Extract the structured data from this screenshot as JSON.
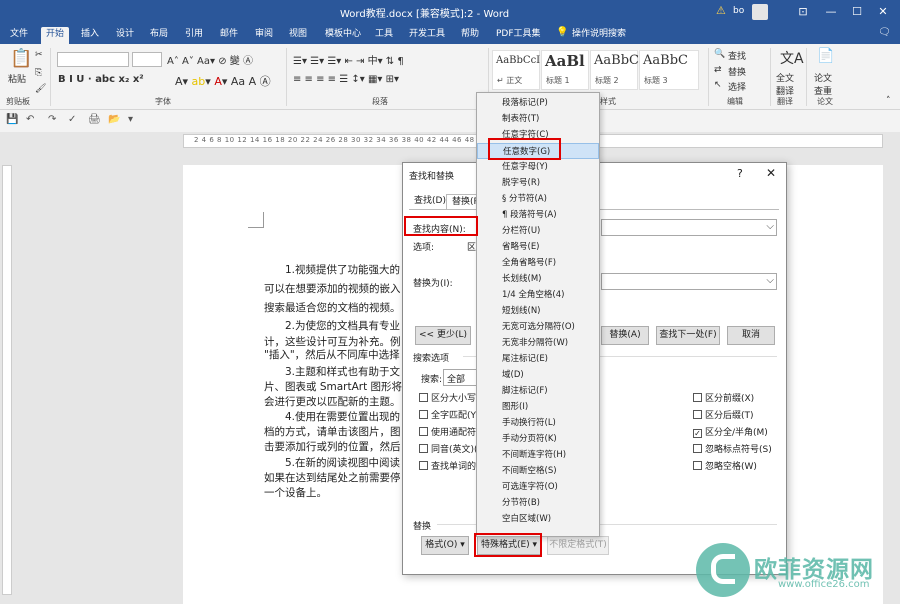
{
  "window": {
    "title": "Word教程.docx [兼容模式]:2 - Word",
    "user": "bo",
    "buttons": {
      "ribbon_display": "⊡",
      "minimize": "—",
      "maximize": "☐",
      "close": "✕"
    }
  },
  "tabs": [
    "文件",
    "开始",
    "插入",
    "设计",
    "布局",
    "引用",
    "邮件",
    "审阅",
    "视图",
    "模板中心",
    "工具",
    "开发工具",
    "帮助",
    "PDF工具集",
    "操作说明搜索"
  ],
  "active_tab": "开始",
  "ribbon": {
    "paste": "粘贴",
    "clipboard": "剪贴板",
    "font_group": "字体",
    "paragraph_group": "段落",
    "styles_group": "样式",
    "editing_group": "编辑",
    "translate_group": "翻译",
    "paper_group": "论文",
    "format_row": "B I U · abc x₂ x²",
    "styles": [
      {
        "preview": "AaBbCcI",
        "name": "↵ 正文"
      },
      {
        "preview": "AaBl",
        "name": "标题 1"
      },
      {
        "preview": "AaBbC",
        "name": "标题 2"
      },
      {
        "preview": "AaBbC",
        "name": "标题 3"
      }
    ],
    "find": "查找",
    "replace": "替换",
    "select": "选择",
    "full_translate": "全文\n翻译",
    "paper_check": "论文\n查重"
  },
  "ruler_text": "2  4  6  8  10  12  14  16  18  20  22  24  26  28  30  32  34  36  38  40  42  44  46  48",
  "document": {
    "lines": [
      "1.视频提供了功能强大的",
      "可以在想要添加的视频的嵌入",
      "搜索最适合您的文档的视频。",
      "2.为使您的文档具有专业",
      "计，这些设计可互为补充。例",
      "\"插入\"，然后从不同库中选择",
      "3.主题和样式也有助于文",
      "片、图表或 SmartArt 图形将",
      "会进行更改以匹配新的主题。",
      "4.使用在需要位置出现的",
      "档的方式，请单击该图片，图",
      "击要添加行或列的位置，然后",
      "5.在新的阅读视图中阅读",
      "如果在达到结尾处之前需要停",
      "一个设备上。"
    ]
  },
  "dialog": {
    "title": "查找和替换",
    "help": "?",
    "close": "✕",
    "tabs": [
      "查找(D)",
      "替换(P)"
    ],
    "find_label": "查找内容(N):",
    "options_label": "选项:",
    "options_value": "区",
    "replace_label": "替换为(I):",
    "less_button": "<< 更少(L)",
    "replace_button": "替换(A)",
    "find_next_button": "查找下一处(F)",
    "cancel_button": "取消",
    "search_options": "搜索选项",
    "search_label": "搜索:",
    "search_value": "全部",
    "left_checks": [
      {
        "label": "区分大小写",
        "checked": false
      },
      {
        "label": "全字匹配(Y)",
        "checked": false
      },
      {
        "label": "使用通配符",
        "checked": false
      },
      {
        "label": "同音(英文)(K)",
        "checked": false
      },
      {
        "label": "查找单词的所",
        "checked": false
      }
    ],
    "right_checks": [
      {
        "label": "区分前缀(X)",
        "checked": false
      },
      {
        "label": "区分后缀(T)",
        "checked": false
      },
      {
        "label": "区分全/半角(M)",
        "checked": true
      },
      {
        "label": "忽略标点符号(S)",
        "checked": false
      },
      {
        "label": "忽略空格(W)",
        "checked": false
      }
    ],
    "replace_section": "替换",
    "format_button": "格式(O) ▾",
    "special_button": "特殊格式(E) ▾",
    "no_format_button": "不限定格式(T)"
  },
  "special_menu": {
    "items": [
      "段落标记(P)",
      "制表符(T)",
      "任意字符(C)",
      "任意数字(G)",
      "任意字母(Y)",
      "脱字号(R)",
      "§ 分节符(A)",
      "¶ 段落符号(A)",
      "分栏符(U)",
      "省略号(E)",
      "全角省略号(F)",
      "长划线(M)",
      "1/4 全角空格(4)",
      "短划线(N)",
      "无宽可选分隔符(O)",
      "无宽非分隔符(W)",
      "尾注标记(E)",
      "域(D)",
      "脚注标记(F)",
      "图形(I)",
      "手动换行符(L)",
      "手动分页符(K)",
      "不间断连字符(H)",
      "不间断空格(S)",
      "可选连字符(O)",
      "分节符(B)",
      "空白区域(W)"
    ],
    "highlighted": "任意数字(G)"
  },
  "watermark": {
    "name": "欧菲资源网",
    "url": "www.office26.com"
  },
  "colors": {
    "titlebar": "#2b579a",
    "ribbon": "#f3f3f3",
    "highlight": "#e00000",
    "menu_hover": "#cfe3f7",
    "watermark": "#58b7a6"
  }
}
